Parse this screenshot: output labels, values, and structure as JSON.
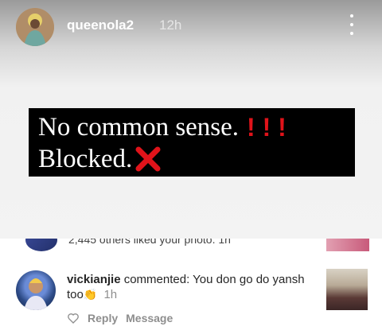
{
  "story": {
    "username": "queenola2",
    "time": "12h",
    "more_icon": "more-vertical-icon"
  },
  "caption": {
    "line1": "No common sense.",
    "line1_marks": "! ! !",
    "line2": "Blocked.",
    "line2_icon": "cross-mark-icon",
    "accent_red": "#e0131a"
  },
  "previous_notification": {
    "text": "2,445 others liked your photo. 1h"
  },
  "comment": {
    "username": "vickianjie",
    "action": "commented:",
    "body": "You don go do yansh too",
    "emoji": "👏",
    "time": "1h",
    "reply_label": "Reply",
    "message_label": "Message"
  }
}
